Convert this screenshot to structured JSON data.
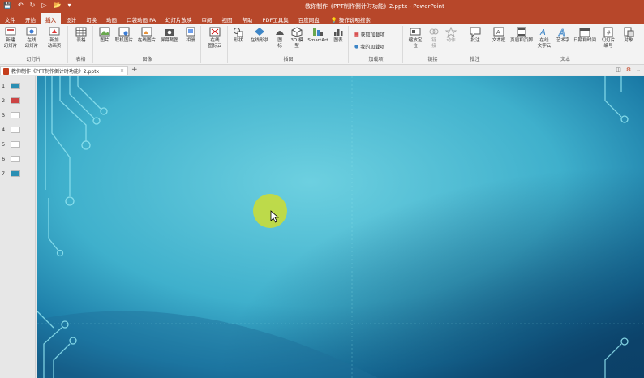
{
  "window": {
    "title": "教你制作《PPT制作倒计时功能》2.pptx  -  PowerPoint",
    "qat": [
      "save-icon",
      "undo-icon",
      "redo-icon",
      "start-icon",
      "open-icon",
      "more-icon"
    ]
  },
  "tabs": {
    "items": [
      "文件",
      "开始",
      "插入",
      "设计",
      "切换",
      "动画",
      "口袋动画 PA",
      "幻灯片放映",
      "审阅",
      "视图",
      "帮助",
      "PDF工具集",
      "百度网盘"
    ],
    "active_index": 2,
    "tell_me": "操作说明搜索"
  },
  "ribbon": {
    "groups": {
      "slides": "幻灯片",
      "tables": "表格",
      "images": "图像",
      "illustrations": "插图",
      "addins": "加载项",
      "links": "链接",
      "comments": "批注",
      "text": "文本"
    },
    "buttons": {
      "new_slide": "新建\n幻灯片",
      "online_slide": "在线\n幻灯片",
      "new_anim_page": "新加\n动画页",
      "table": "表格",
      "picture": "图片",
      "online_picture": "联机图片",
      "online_image": "在线图片",
      "screenshot": "屏幕截图",
      "album": "相册",
      "online_icon_cloud": "在线\n图标云",
      "shapes": "形状",
      "online_shapes": "在线形状",
      "icons": "图\n标",
      "models_3d": "3D 模\n型",
      "smartart": "SmartArt",
      "chart": "图表",
      "get_addins": "获取加载项",
      "my_addins": "我的加载项",
      "zoom": "缩放定\n位",
      "link": "链\n接",
      "action": "动作",
      "comment": "批注",
      "textbox": "文本框",
      "header_footer": "页眉和页脚",
      "online_wordcloud": "在线\n文字云",
      "wordart": "艺术字",
      "datetime": "日期和时间",
      "slide_number": "幻灯片\n编号",
      "object": "对象"
    }
  },
  "doc_tab": {
    "label": "教你制作《PPT制作倒计时功能》2.pptx",
    "close": "×",
    "new": "+"
  },
  "thumbnails": [
    "1",
    "2",
    "3",
    "4",
    "5",
    "6",
    "7"
  ],
  "colors": {
    "accent": "#b7472a",
    "slide_bg_center": "#5fc9dc",
    "slide_bg_edge": "#0e4f7a",
    "circuit": "#8fe3f0",
    "cursor_highlight": "#c8dc3a"
  }
}
